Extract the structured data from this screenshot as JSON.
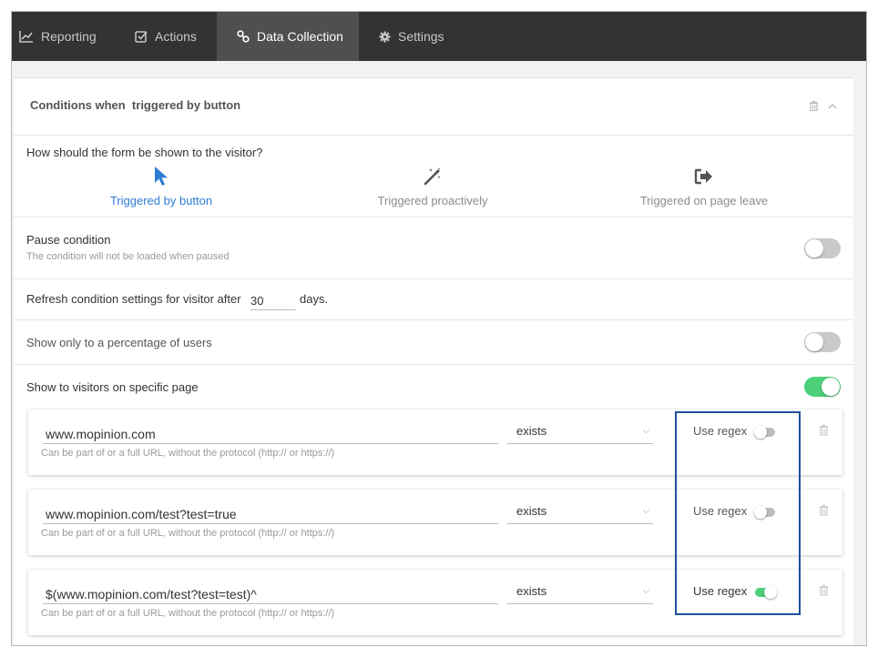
{
  "nav": {
    "tabs": [
      {
        "label": "Reporting",
        "icon": "chart-line-icon",
        "active": false
      },
      {
        "label": "Actions",
        "icon": "checkbox-icon",
        "active": false
      },
      {
        "label": "Data Collection",
        "icon": "link-icon",
        "active": true
      },
      {
        "label": "Settings",
        "icon": "gear-icon",
        "active": false
      }
    ]
  },
  "condition": {
    "title": "Conditions when  triggered by button"
  },
  "trigger": {
    "question": "How should the form be shown to the visitor?",
    "options": [
      {
        "label": "Triggered by button",
        "icon": "cursor-pointer-icon",
        "selected": true
      },
      {
        "label": "Triggered proactively",
        "icon": "magic-wand-icon",
        "selected": false
      },
      {
        "label": "Triggered on page leave",
        "icon": "sign-out-icon",
        "selected": false
      }
    ]
  },
  "pause": {
    "title": "Pause condition",
    "subtitle": "The condition will not be loaded when paused",
    "enabled": false
  },
  "refresh": {
    "prefix": "Refresh condition settings for visitor after",
    "value": "30",
    "suffix": "days."
  },
  "percentage": {
    "label": "Show only to a percentage of users",
    "enabled": false
  },
  "specific_page": {
    "label": "Show to visitors on specific page",
    "enabled": true
  },
  "url_rules": [
    {
      "url": "www.mopinion.com",
      "hint": "Can be part of or a full URL, without the protocol (http:// or https://)",
      "match": "exists",
      "regex_label": "Use regex",
      "regex": false
    },
    {
      "url": "www.mopinion.com/test?test=true",
      "hint": "Can be part of or a full URL, without the protocol (http:// or https://)",
      "match": "exists",
      "regex_label": "Use regex",
      "regex": false
    },
    {
      "url": "$(www.mopinion.com/test?test=test)^",
      "hint": "Can be part of or a full URL, without the protocol (http:// or https://)",
      "match": "exists",
      "regex_label": "Use regex",
      "regex": true
    }
  ],
  "colors": {
    "nav_bg": "#333333",
    "nav_active": "#4f4f4f",
    "accent_blue": "#2f7cd6",
    "toggle_on": "#4cd07a",
    "highlight_border": "#1f4e9c"
  }
}
